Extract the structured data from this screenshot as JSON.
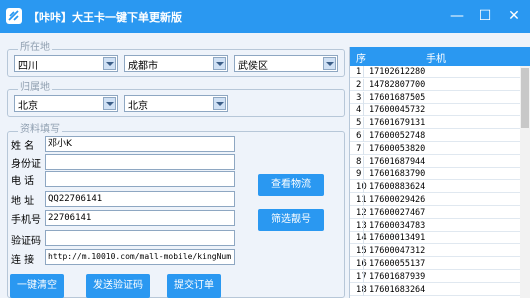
{
  "window": {
    "title": "【咔咔】大王卡一键下单更新版",
    "minimize": "—",
    "maximize": "☐",
    "close": "✕",
    "icon": "app-logo-icon"
  },
  "location": {
    "legend": "所在地",
    "province": "四川",
    "city": "成都市",
    "district": "武侯区"
  },
  "home": {
    "legend": "归属地",
    "province": "北京",
    "city": "北京"
  },
  "form": {
    "legend": "资料填写",
    "name_label": "姓 名",
    "name_value": "邓小K",
    "id_label": "身份证",
    "id_value": "",
    "phone_label": "电 话",
    "phone_value": "",
    "address_label": "地 址",
    "address_value": "QQ22706141",
    "mobile_label": "手机号",
    "mobile_value": "22706141",
    "code_label": "验证码",
    "code_value": "",
    "link_label": "连 接",
    "link_value": "http://m.10010.com/mall-mobile/kingNum"
  },
  "buttons": {
    "view_logistics": "查看物流",
    "filter_numbers": "筛选靓号",
    "clear": "一键清空",
    "send_code": "发送验证码",
    "submit": "提交订单"
  },
  "table": {
    "col_index": "序",
    "col_phone": "手机",
    "rows": [
      {
        "i": "1",
        "p": "17102612280"
      },
      {
        "i": "2",
        "p": "14782807700"
      },
      {
        "i": "3",
        "p": "17601687505"
      },
      {
        "i": "4",
        "p": "17600045732"
      },
      {
        "i": "5",
        "p": "17601679131"
      },
      {
        "i": "6",
        "p": "17600052748"
      },
      {
        "i": "7",
        "p": "17600053820"
      },
      {
        "i": "8",
        "p": "17601687944"
      },
      {
        "i": "9",
        "p": "17601683790"
      },
      {
        "i": "10",
        "p": "17600883624"
      },
      {
        "i": "11",
        "p": "17600029426"
      },
      {
        "i": "12",
        "p": "17600027467"
      },
      {
        "i": "13",
        "p": "17600034783"
      },
      {
        "i": "14",
        "p": "17600013491"
      },
      {
        "i": "15",
        "p": "17600047312"
      },
      {
        "i": "16",
        "p": "17600055137"
      },
      {
        "i": "17",
        "p": "17601687939"
      },
      {
        "i": "18",
        "p": "17601683264"
      }
    ]
  },
  "colors": {
    "accent": "#2a98f1",
    "background": "#eef3fa"
  }
}
